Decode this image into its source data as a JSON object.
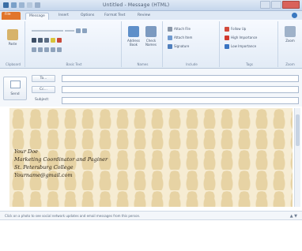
{
  "window": {
    "title": "Untitled - Message (HTML)"
  },
  "ribbon": {
    "tabs": [
      "File",
      "Message",
      "Insert",
      "Options",
      "Format Text",
      "Review"
    ],
    "active_tab": "Message",
    "groups": {
      "clipboard": {
        "label": "Clipboard",
        "paste": "Paste"
      },
      "basic_text": {
        "label": "Basic Text"
      },
      "names": {
        "label": "Names",
        "address_book": "Address Book",
        "check_names": "Check Names"
      },
      "include": {
        "label": "Include",
        "attach_file": "Attach File",
        "attach_item": "Attach Item",
        "signature": "Signature"
      },
      "tags": {
        "label": "Tags",
        "follow_up": "Follow Up",
        "high_importance": "High Importance",
        "low_importance": "Low Importance"
      },
      "zoom": {
        "label": "Zoom",
        "zoom": "Zoom"
      }
    }
  },
  "compose": {
    "send_label": "Send",
    "to_label": "To...",
    "cc_label": "Cc...",
    "subject_label": "Subject:",
    "to_value": "",
    "cc_value": "",
    "subject_value": ""
  },
  "signature": {
    "lines": [
      "Your Doe",
      "Marketing Coordinator and Paginer",
      "St. Petersburg College",
      "Yourname@gmail.com"
    ]
  },
  "people_pane": {
    "text": "Click on a photo to see social network updates and email messages from this person."
  },
  "colors": {
    "file_tab": "#e1752b",
    "stationery_bg": "#f6ecd3",
    "bear": "#e7d3a4"
  }
}
